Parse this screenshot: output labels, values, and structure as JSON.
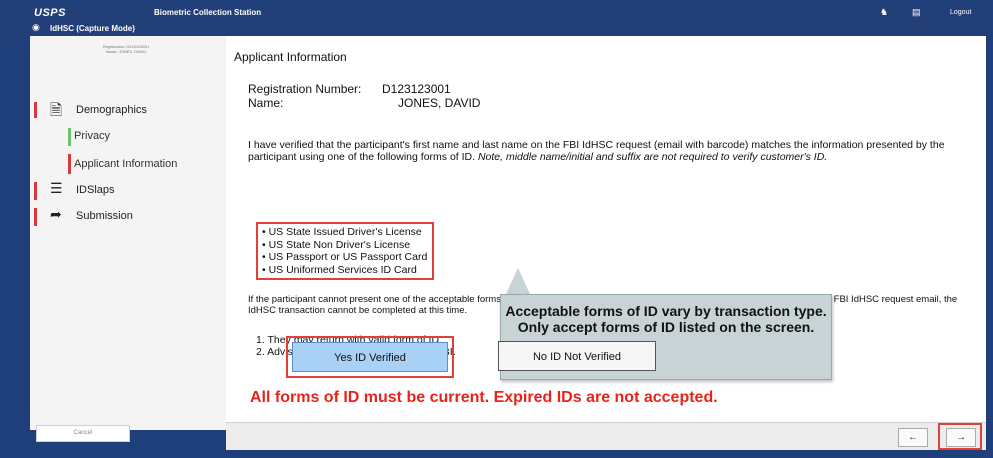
{
  "titlebar": {
    "logo": "USPS",
    "title": "Biometric Collection Station",
    "logout": "Logout",
    "person_icon": "person-icon",
    "print_icon": "printer-icon"
  },
  "subtitlebar": {
    "text": "IdHSC (Capture Mode)",
    "icon": "fingerprint-icon"
  },
  "sidebar": {
    "registration": "Registration: D123123001",
    "name": "Name: JONES, DAVID",
    "items": [
      {
        "label": "Demographics",
        "icon": "document-icon"
      },
      {
        "label": "IDSlaps",
        "icon": "fingerprint-scanner-icon"
      },
      {
        "label": "Submission",
        "icon": "submit-arrow-icon"
      }
    ],
    "subitems": [
      {
        "label": "Privacy"
      },
      {
        "label": "Applicant Information"
      }
    ],
    "cancel": "Cancel"
  },
  "main": {
    "section_title": "Applicant Information",
    "reg_label": "Registration Number:",
    "reg_value": "D123123001",
    "name_label": "Name:",
    "name_value": "JONES, DAVID",
    "para1_text": "I have verified that the participant's first name and last name on the FBI IdHSC request (email with barcode) matches the information presented by the participant using one of the following forms of ID.",
    "para1_italic": "Note, middle name/initial and suffix are not required to verify customer's ID.",
    "id_list": [
      "US State Issued Driver's License",
      "US State Non Driver's License",
      "US Passport or US Passport Card",
      "US Uniformed Services ID Card"
    ],
    "para2": "If the participant cannot present one of the acceptable forms of ID listed, or the information on the ID does not match the information on the FBI IdHSC request email, the IdHSC transaction cannot be completed at this time.",
    "step1": "1.  They may return with valid form of ID.",
    "step2": "2.  Advise the participant to contact the FBI.",
    "tooltip_line1": "Acceptable forms of ID vary by transaction type.",
    "tooltip_line2": "Only accept forms of ID listed on the screen.",
    "yes_button": "Yes ID Verified",
    "no_button": "No ID Not Verified",
    "warning": "All forms of ID must be current. Expired IDs are not accepted."
  },
  "footer": {
    "back": "←",
    "next": "→"
  },
  "colors": {
    "frame": "#1f3f7a",
    "highlight": "#e0403a",
    "yes_button_bg": "#a9d0f5",
    "tooltip_bg": "#c7d3d4",
    "warning": "#e8231a"
  }
}
